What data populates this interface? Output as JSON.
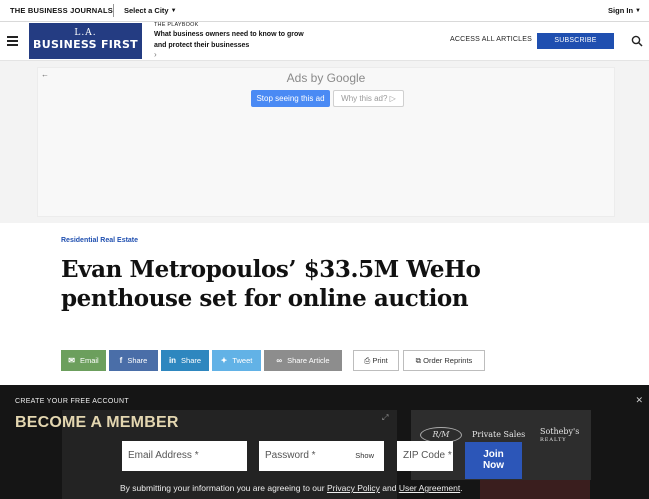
{
  "topbar": {
    "brand": "THE BUSINESS JOURNALS",
    "select_city": "Select a City",
    "sign_in": "Sign In"
  },
  "header": {
    "logo_line1": "L.A.",
    "logo_line2": "BUSINESS FIRST",
    "playbook_kicker": "THE PLAYBOOK",
    "playbook_headline": "What business owners need to know to grow and protect their businesses",
    "access_all": "ACCESS ALL ARTICLES",
    "subscribe": "SUBSCRIBE",
    "colors": {
      "logo_bg": "#243c82",
      "subscribe_bg": "#1f4fb0"
    }
  },
  "ad": {
    "ads_by": "Ads by Google",
    "stop_seeing": "Stop seeing this ad",
    "why_this_ad": "Why this ad?"
  },
  "article": {
    "category": "Residential Real Estate",
    "title": "Evan Metropoulos’ $33.5M WeHo penthouse set for online auction"
  },
  "share": {
    "email": "Email",
    "facebook": "Share",
    "linkedin": "Share",
    "twitter": "Tweet",
    "share_article": "Share Article",
    "print": "Print",
    "order_reprints": "Order Reprints"
  },
  "member": {
    "kicker": "CREATE YOUR FREE ACCOUNT",
    "title": "BECOME A MEMBER",
    "email_placeholder": "Email Address *",
    "password_placeholder": "Password *",
    "show": "Show",
    "zip_placeholder": "ZIP Code *",
    "join_line1": "Join",
    "join_line2": "Now",
    "legal_prefix": "By submitting your information you are agreeing to our",
    "privacy_policy": "Privacy Policy",
    "and": "and",
    "user_agreement": "User Agreement",
    "period": ".",
    "bg_ad_logo": "R/M",
    "bg_ad_private_sales": "Private Sales",
    "bg_ad_sothebys": "Sotheby's",
    "bg_ad_sothebys_sub": "REALTY"
  }
}
